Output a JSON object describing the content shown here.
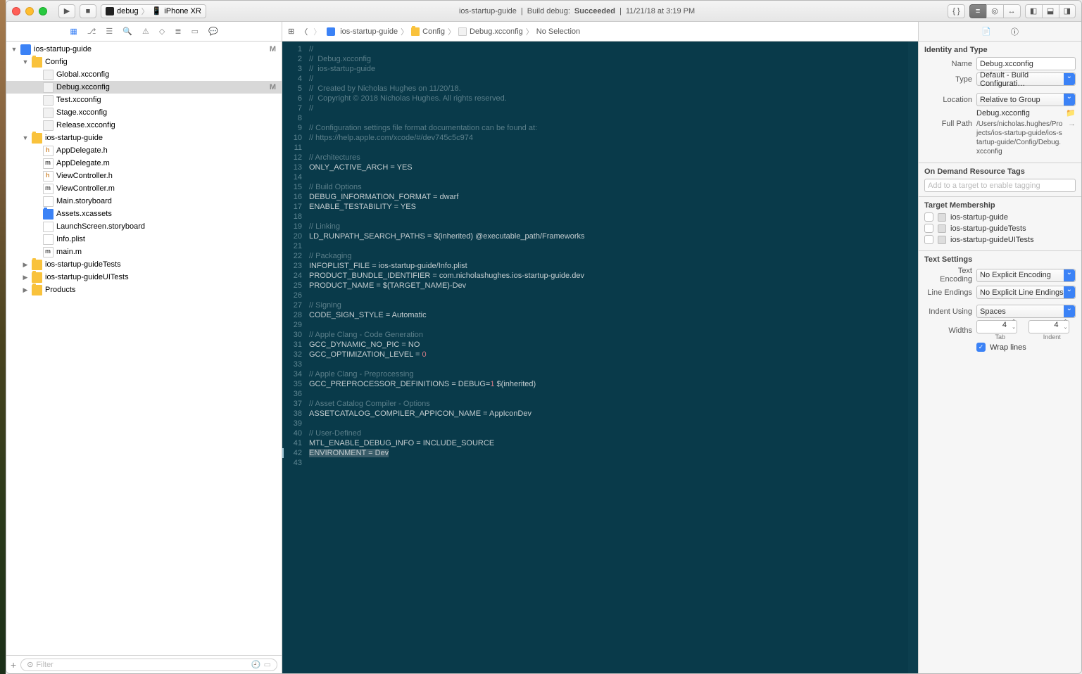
{
  "toolbar": {
    "scheme_name": "debug",
    "scheme_device": "iPhone XR",
    "status_project": "ios-startup-guide",
    "status_build": "Build debug:",
    "status_result": "Succeeded",
    "status_time": "11/21/18 at 3:19 PM"
  },
  "navigator": {
    "filter_placeholder": "Filter",
    "tree": [
      {
        "d": 0,
        "open": true,
        "kind": "bproj",
        "label": "ios-startup-guide",
        "m": "M"
      },
      {
        "d": 1,
        "open": true,
        "kind": "fold",
        "label": "Config"
      },
      {
        "d": 2,
        "kind": "cfg",
        "label": "Global.xcconfig"
      },
      {
        "d": 2,
        "kind": "cfg",
        "label": "Debug.xcconfig",
        "sel": true,
        "m": "M"
      },
      {
        "d": 2,
        "kind": "cfg",
        "label": "Test.xcconfig"
      },
      {
        "d": 2,
        "kind": "cfg",
        "label": "Stage.xcconfig"
      },
      {
        "d": 2,
        "kind": "cfg",
        "label": "Release.xcconfig"
      },
      {
        "d": 1,
        "open": true,
        "kind": "fold",
        "label": "ios-startup-guide"
      },
      {
        "d": 2,
        "kind": "h",
        "label": "AppDelegate.h"
      },
      {
        "d": 2,
        "kind": "m",
        "label": "AppDelegate.m"
      },
      {
        "d": 2,
        "kind": "h",
        "label": "ViewController.h"
      },
      {
        "d": 2,
        "kind": "m",
        "label": "ViewController.m"
      },
      {
        "d": 2,
        "kind": "sb",
        "label": "Main.storyboard"
      },
      {
        "d": 2,
        "kind": "bfold",
        "label": "Assets.xcassets"
      },
      {
        "d": 2,
        "kind": "sb",
        "label": "LaunchScreen.storyboard"
      },
      {
        "d": 2,
        "kind": "pl",
        "label": "Info.plist"
      },
      {
        "d": 2,
        "kind": "m",
        "label": "main.m"
      },
      {
        "d": 1,
        "open": false,
        "kind": "fold",
        "label": "ios-startup-guideTests"
      },
      {
        "d": 1,
        "open": false,
        "kind": "fold",
        "label": "ios-startup-guideUITests"
      },
      {
        "d": 1,
        "open": false,
        "kind": "fold",
        "label": "Products"
      }
    ]
  },
  "jumpbar": {
    "parts": [
      "ios-startup-guide",
      "Config",
      "Debug.xcconfig",
      "No Selection"
    ]
  },
  "code": {
    "lines": [
      "//",
      "//  Debug.xcconfig",
      "//  ios-startup-guide",
      "//",
      "//  Created by Nicholas Hughes on 11/20/18.",
      "//  Copyright © 2018 Nicholas Hughes. All rights reserved.",
      "//",
      "",
      "// Configuration settings file format documentation can be found at:",
      "// https://help.apple.com/xcode/#/dev745c5c974",
      "",
      "// Architectures",
      "ONLY_ACTIVE_ARCH = YES",
      "",
      "// Build Options",
      "DEBUG_INFORMATION_FORMAT = dwarf",
      "ENABLE_TESTABILITY = YES",
      "",
      "// Linking",
      "LD_RUNPATH_SEARCH_PATHS = $(inherited) @executable_path/Frameworks",
      "",
      "// Packaging",
      "INFOPLIST_FILE = ios-startup-guide/Info.plist",
      "PRODUCT_BUNDLE_IDENTIFIER = com.nicholashughes.ios-startup-guide.dev",
      "PRODUCT_NAME = $(TARGET_NAME)-Dev",
      "",
      "// Signing",
      "CODE_SIGN_STYLE = Automatic",
      "",
      "// Apple Clang - Code Generation",
      "GCC_DYNAMIC_NO_PIC = NO",
      "GCC_OPTIMIZATION_LEVEL = 0",
      "",
      "// Apple Clang - Preprocessing",
      "GCC_PREPROCESSOR_DEFINITIONS = DEBUG=1 $(inherited)",
      "",
      "// Asset Catalog Compiler - Options",
      "ASSETCATALOG_COMPILER_APPICON_NAME = AppIconDev",
      "",
      "// User-Defined",
      "MTL_ENABLE_DEBUG_INFO = INCLUDE_SOURCE",
      "ENVIRONMENT = Dev",
      ""
    ],
    "cursor_line": 42,
    "highlight_line": 42
  },
  "inspector": {
    "identity_header": "Identity and Type",
    "name_label": "Name",
    "name_value": "Debug.xcconfig",
    "type_label": "Type",
    "type_value": "Default - Build Configurati…",
    "location_label": "Location",
    "location_value": "Relative to Group",
    "location_file": "Debug.xcconfig",
    "fullpath_label": "Full Path",
    "fullpath_value": "/Users/nicholas.hughes/Projects/ios-startup-guide/ios-startup-guide/Config/Debug.xcconfig",
    "ondemand_header": "On Demand Resource Tags",
    "ondemand_placeholder": "Add to a target to enable tagging",
    "membership_header": "Target Membership",
    "targets": [
      {
        "name": "ios-startup-guide",
        "checked": false
      },
      {
        "name": "ios-startup-guideTests",
        "checked": false
      },
      {
        "name": "ios-startup-guideUITests",
        "checked": false
      }
    ],
    "text_header": "Text Settings",
    "encoding_label": "Text Encoding",
    "encoding_value": "No Explicit Encoding",
    "endings_label": "Line Endings",
    "endings_value": "No Explicit Line Endings",
    "indent_label": "Indent Using",
    "indent_value": "Spaces",
    "widths_label": "Widths",
    "tab_value": "4",
    "indent_value_num": "4",
    "tab_sub": "Tab",
    "indent_sub": "Indent",
    "wrap_label": "Wrap lines"
  }
}
